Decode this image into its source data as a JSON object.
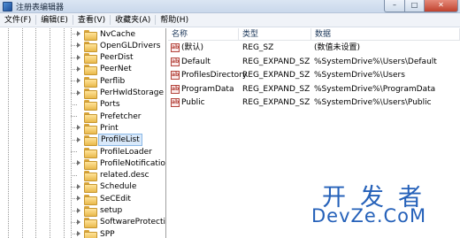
{
  "window": {
    "title": "注册表编辑器",
    "min": "–",
    "max": "□",
    "close": "✕"
  },
  "menu": [
    "文件(F)",
    "编辑(E)",
    "查看(V)",
    "收藏夹(A)",
    "帮助(H)"
  ],
  "tree": {
    "items": [
      {
        "label": "NvCache",
        "expandable": true
      },
      {
        "label": "OpenGLDrivers",
        "expandable": true
      },
      {
        "label": "PeerDist",
        "expandable": true
      },
      {
        "label": "PeerNet",
        "expandable": true
      },
      {
        "label": "Perflib",
        "expandable": true
      },
      {
        "label": "PerHwIdStorage",
        "expandable": true
      },
      {
        "label": "Ports",
        "expandable": false
      },
      {
        "label": "Prefetcher",
        "expandable": false
      },
      {
        "label": "Print",
        "expandable": true
      },
      {
        "label": "ProfileList",
        "expandable": true,
        "selected": true
      },
      {
        "label": "ProfileLoader",
        "expandable": false
      },
      {
        "label": "ProfileNotification",
        "expandable": true
      },
      {
        "label": "related.desc",
        "expandable": false
      },
      {
        "label": "Schedule",
        "expandable": true
      },
      {
        "label": "SeCEdit",
        "expandable": true
      },
      {
        "label": "setup",
        "expandable": true
      },
      {
        "label": "SoftwareProtectionPlatform",
        "expandable": true
      },
      {
        "label": "SPP",
        "expandable": true
      }
    ]
  },
  "list": {
    "columns": [
      "名称",
      "类型",
      "数据"
    ],
    "rows": [
      {
        "name": "(默认)",
        "type": "REG_SZ",
        "data": "(数值未设置)"
      },
      {
        "name": "Default",
        "type": "REG_EXPAND_SZ",
        "data": "%SystemDrive%\\Users\\Default"
      },
      {
        "name": "ProfilesDirectory",
        "type": "REG_EXPAND_SZ",
        "data": "%SystemDrive%\\Users"
      },
      {
        "name": "ProgramData",
        "type": "REG_EXPAND_SZ",
        "data": "%SystemDrive%\\ProgramData"
      },
      {
        "name": "Public",
        "type": "REG_EXPAND_SZ",
        "data": "%SystemDrive%\\Users\\Public"
      }
    ],
    "value_icon": "ab-string-icon"
  },
  "watermark": {
    "line1": "开发者",
    "line2": "DevZe.CoM"
  },
  "colors": {
    "selection": "#d9e9fa",
    "watermark": "#2561b9"
  }
}
